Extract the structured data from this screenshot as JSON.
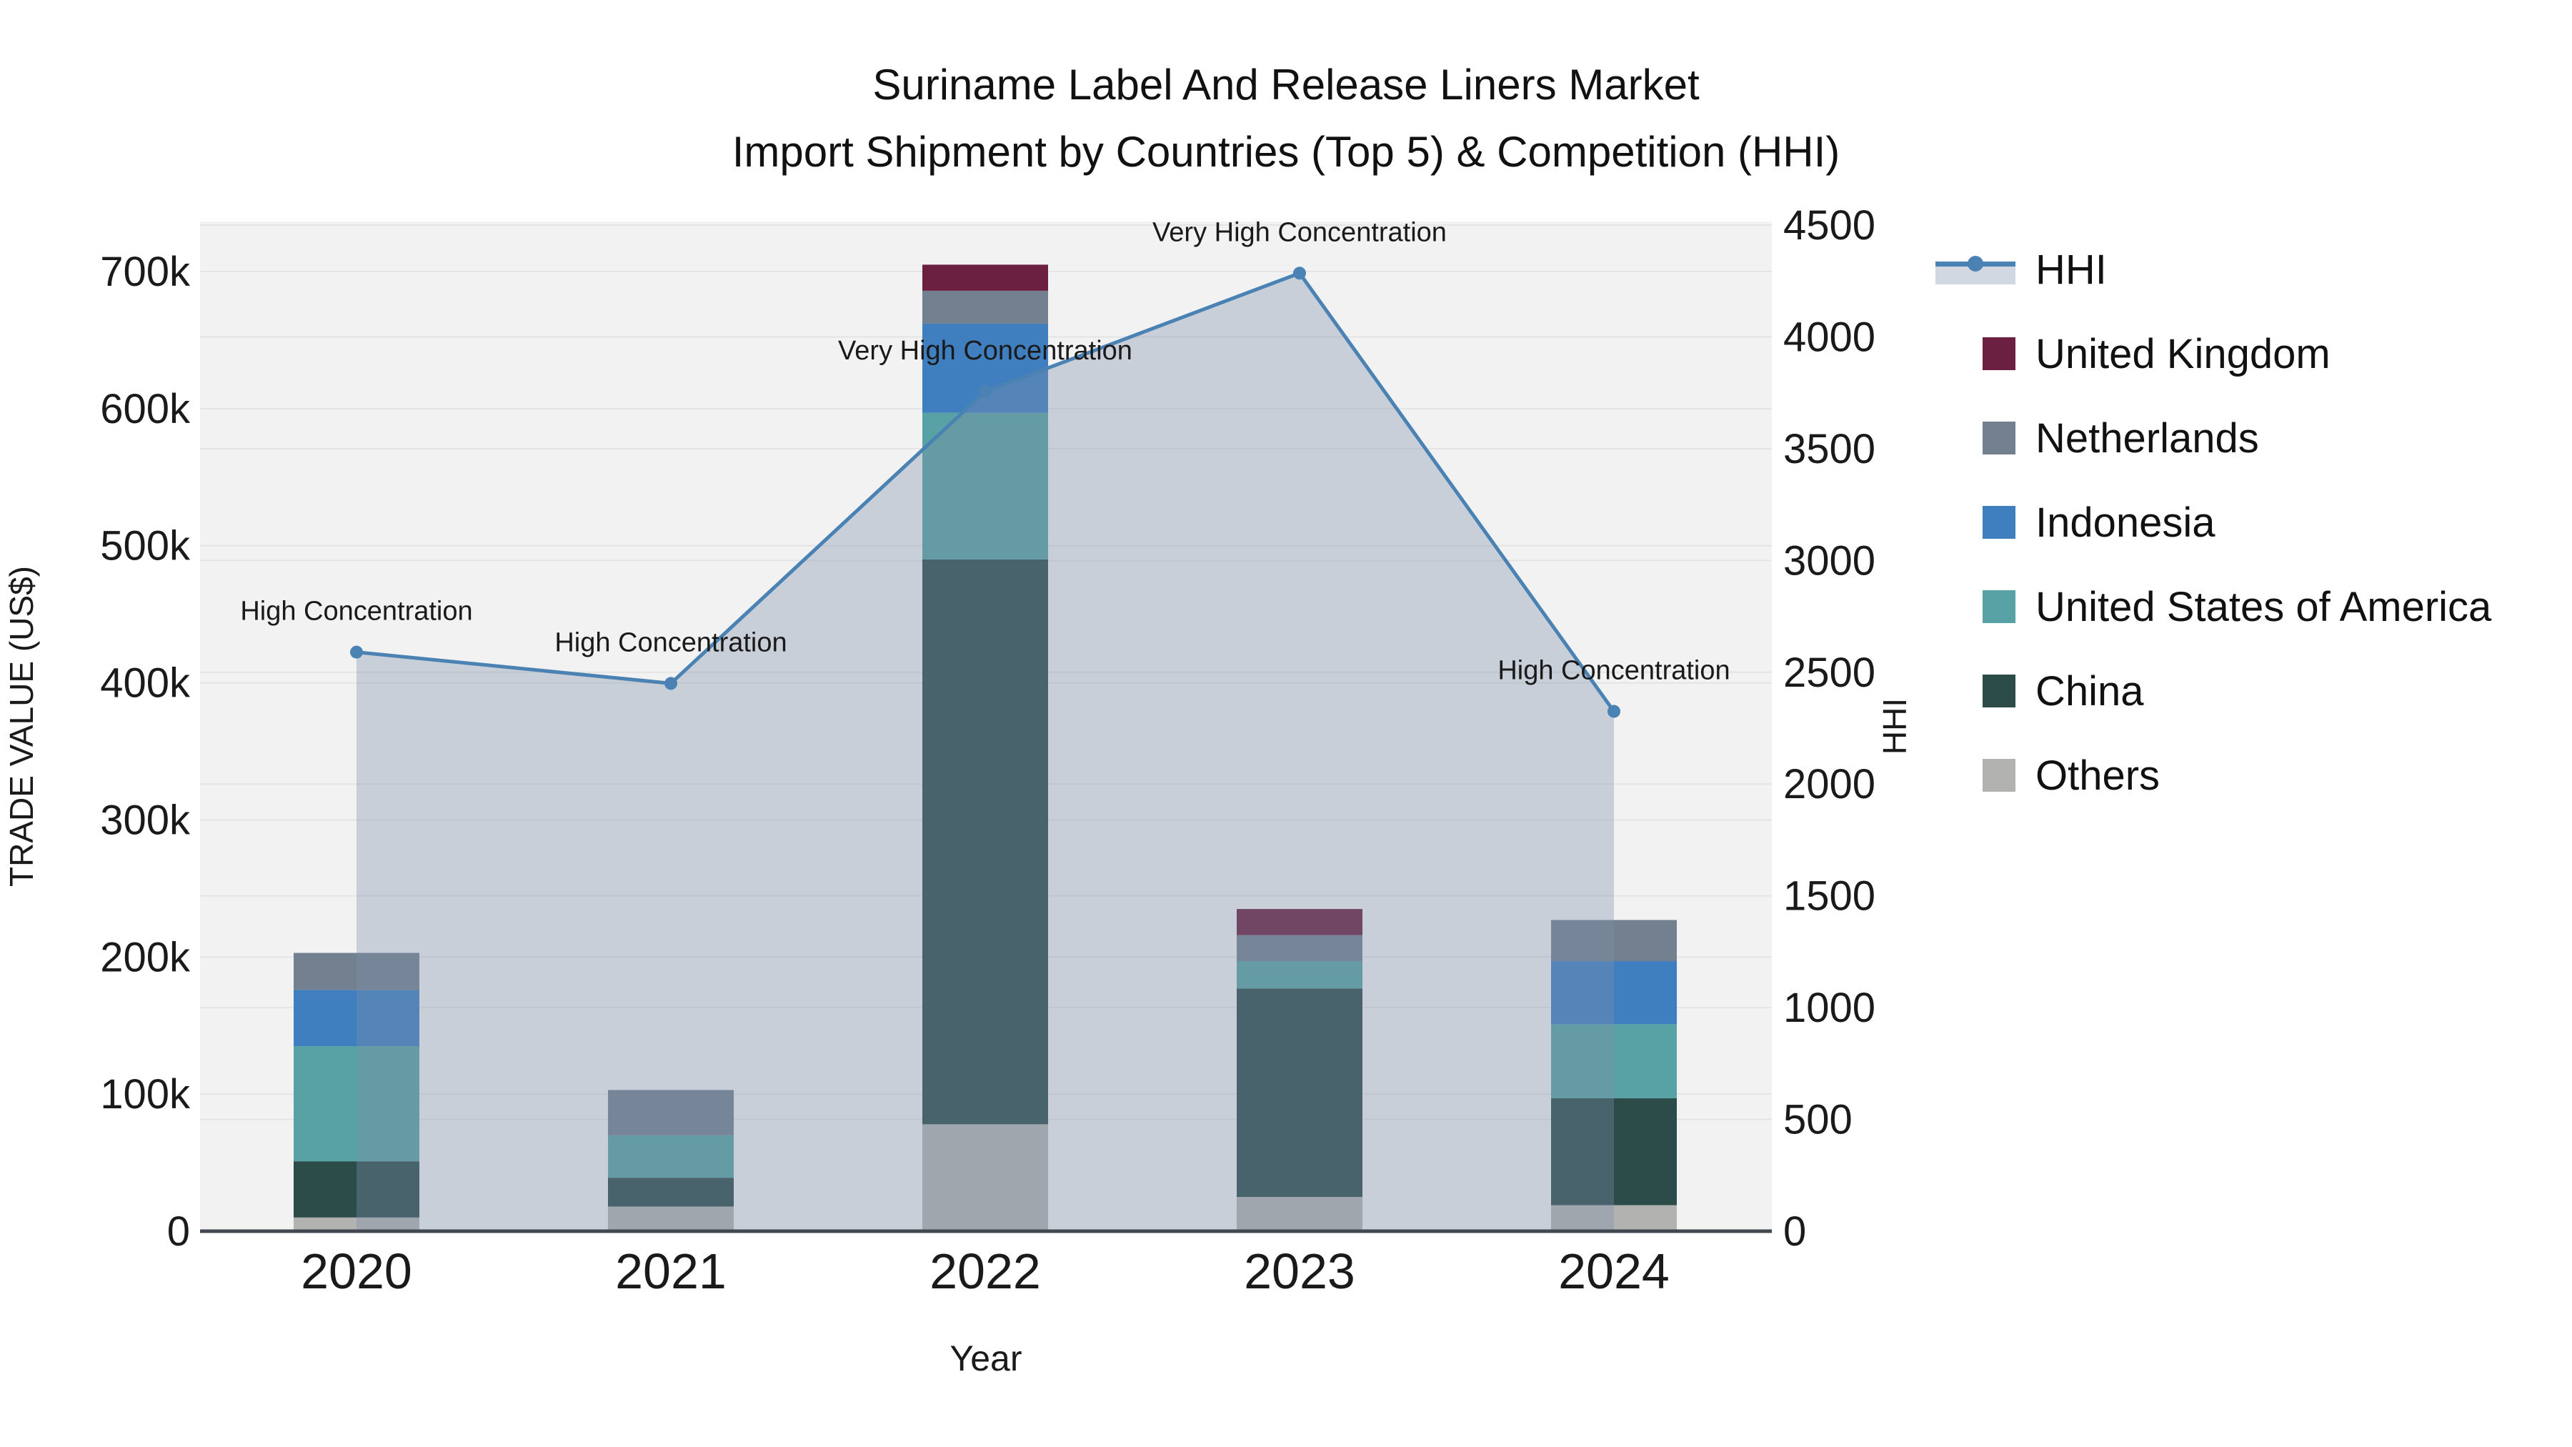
{
  "title": {
    "line1": "Suriname Label And Release Liners Market",
    "line2": "Import Shipment by Countries (Top 5) & Competition (HHI)"
  },
  "axes": {
    "x_title": "Year",
    "y_left_title": "TRADE VALUE (US$)",
    "y_right_title": "HHI",
    "x_ticks": [
      "2020",
      "2021",
      "2022",
      "2023",
      "2024"
    ],
    "y_left_ticks": [
      {
        "label": "0",
        "value": 0
      },
      {
        "label": "100k",
        "value": 100
      },
      {
        "label": "200k",
        "value": 200
      },
      {
        "label": "300k",
        "value": 300
      },
      {
        "label": "400k",
        "value": 400
      },
      {
        "label": "500k",
        "value": 500
      },
      {
        "label": "600k",
        "value": 600
      },
      {
        "label": "700k",
        "value": 700
      }
    ],
    "y_right_ticks": [
      0,
      500,
      1000,
      1500,
      2000,
      2500,
      3000,
      3500,
      4000,
      4500
    ]
  },
  "legend": {
    "items": [
      {
        "label": "HHI",
        "color": "#4a82b4",
        "type": "line"
      },
      {
        "label": "United Kingdom",
        "color": "#6b1f41",
        "type": "square"
      },
      {
        "label": "Netherlands",
        "color": "#72808f",
        "type": "square"
      },
      {
        "label": "Indonesia",
        "color": "#3f7fc0",
        "type": "square"
      },
      {
        "label": "United States of America",
        "color": "#58a1a4",
        "type": "square"
      },
      {
        "label": "China",
        "color": "#2c4c4a",
        "type": "square"
      },
      {
        "label": "Others",
        "color": "#b2b2b0",
        "type": "square"
      }
    ]
  },
  "chart_data": {
    "type": [
      "stacked-bar",
      "line-area"
    ],
    "x": [
      2020,
      2021,
      2022,
      2023,
      2024
    ],
    "units_left": "thousand US$",
    "bar_series": [
      {
        "name": "United Kingdom",
        "color": "#6b1f41",
        "values": [
          0,
          0,
          19,
          19,
          0
        ]
      },
      {
        "name": "Netherlands",
        "color": "#72808f",
        "values": [
          27,
          33,
          24,
          19,
          30
        ]
      },
      {
        "name": "Indonesia",
        "color": "#3f7fc0",
        "values": [
          41,
          0,
          65,
          0,
          46
        ]
      },
      {
        "name": "United States of America",
        "color": "#58a1a4",
        "values": [
          84,
          31,
          107,
          20,
          54
        ]
      },
      {
        "name": "China",
        "color": "#2c4c4a",
        "values": [
          41,
          21,
          412,
          152,
          78
        ]
      },
      {
        "name": "Others",
        "color": "#b2b2b0",
        "values": [
          10,
          18,
          78,
          25,
          19
        ]
      }
    ],
    "bar_totals": [
      203,
      103,
      705,
      235,
      227
    ],
    "hhi": {
      "name": "HHI",
      "color": "#4a82b4",
      "area_color": "rgba(125,143,168,0.35)",
      "values": [
        2590,
        2450,
        3755,
        4285,
        2325
      ],
      "axis_max": 4500
    },
    "annotations": [
      "High Concentration",
      "High Concentration",
      "Very High Concentration",
      "Very High Concentration",
      "High Concentration"
    ],
    "ylim_left": [
      0,
      736
    ],
    "ylim_right": [
      0,
      4500
    ],
    "grid": true,
    "legend_position": "right"
  },
  "colors": {
    "plot_bg": "#f2f2f2",
    "grid": "#e4e4e4",
    "axis_line": "#424750",
    "text": "#1a1a1a",
    "page_bg": "#ffffff"
  }
}
